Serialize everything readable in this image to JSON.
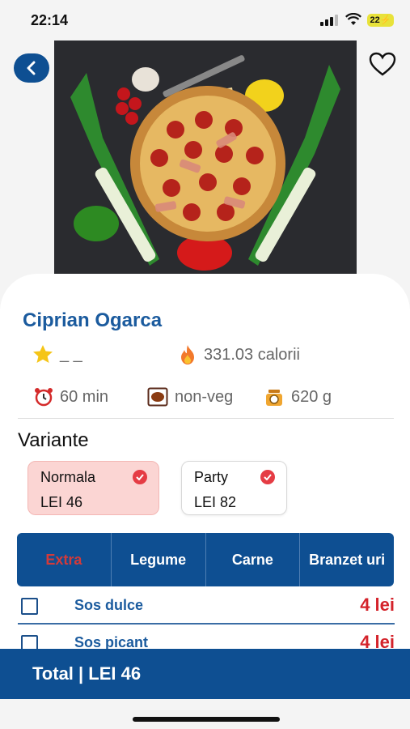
{
  "status_bar": {
    "time": "22:14",
    "battery": "22"
  },
  "nav": {
    "back_icon": "chevron-left-icon",
    "favorite_icon": "heart-outline-icon"
  },
  "hero": {
    "image": "pizza-with-vegetables-photo"
  },
  "product": {
    "title": "Ciprian Ogarca",
    "rating": "_ _",
    "calories": "331.03 calorii",
    "time": "60 min",
    "type": "non-veg",
    "weight": "620 g"
  },
  "variants": {
    "title": "Variante",
    "items": [
      {
        "name": "Normala",
        "price": "LEI 46",
        "selected": true
      },
      {
        "name": "Party",
        "price": "LEI 82",
        "selected": false
      }
    ]
  },
  "tabs": [
    {
      "label": "Extra",
      "active": true
    },
    {
      "label": "Legume",
      "active": false
    },
    {
      "label": "Carne",
      "active": false
    },
    {
      "label": "Branzet uri",
      "active": false
    }
  ],
  "extras": [
    {
      "label": "Sos dulce",
      "price": "4 lei"
    },
    {
      "label": "Sos picant",
      "price": "4 lei"
    }
  ],
  "total": {
    "label": "Total | LEI  46"
  },
  "colors": {
    "primary": "#0e4f92",
    "accent_red": "#d4232b",
    "selected_bg": "#fbd5d3"
  }
}
